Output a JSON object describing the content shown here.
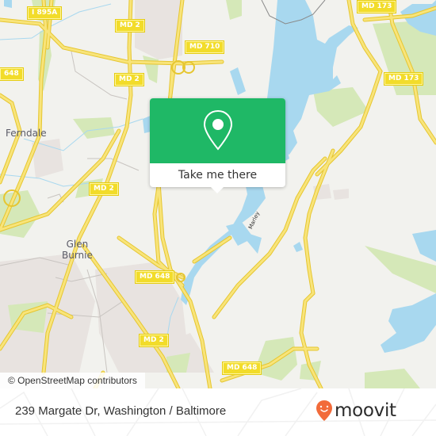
{
  "map": {
    "attribution": "© OpenStreetMap contributors",
    "colors": {
      "land": "#f2f2ee",
      "water": "#a8d8ef",
      "park": "#d5e8b8",
      "urban": "#e8e3e0",
      "road": "#f5dd55",
      "road_casing": "#e6c630",
      "shield": "#f2dc2a"
    },
    "road_shields": [
      {
        "id": "i895a",
        "label": "I 895A"
      },
      {
        "id": "md2-a",
        "label": "MD 2"
      },
      {
        "id": "md710",
        "label": "MD 710"
      },
      {
        "id": "md648-a",
        "label": "648"
      },
      {
        "id": "md2-b",
        "label": "MD 2"
      },
      {
        "id": "md173-a",
        "label": "MD 173"
      },
      {
        "id": "md173-b",
        "label": "MD 173"
      },
      {
        "id": "md2-c",
        "label": "MD 2"
      },
      {
        "id": "md648-b",
        "label": "MD 648"
      },
      {
        "id": "md2-d",
        "label": "MD 2"
      },
      {
        "id": "md648-c",
        "label": "MD 648"
      }
    ],
    "places": [
      {
        "id": "ferndale",
        "label": "Ferndale"
      },
      {
        "id": "glen-burnie",
        "label": "Glen\nBurnie"
      }
    ],
    "road_name": "Marley"
  },
  "popup": {
    "icon": "map-pin-icon",
    "button_label": "Take me there",
    "color": "#1fb866"
  },
  "footer": {
    "address": "239 Margate Dr, Washington / Baltimore",
    "brand": "moovit",
    "brand_color": "#f26b3a"
  }
}
